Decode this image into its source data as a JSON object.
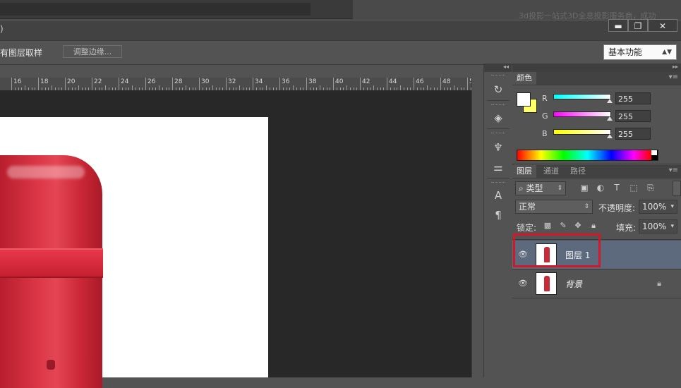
{
  "top": {
    "caption": "3d投影一站式3D全息投影服务商，成功"
  },
  "titlebar": {
    "paren": ")",
    "minimize": "▬",
    "restore": "❐",
    "close": "✕"
  },
  "options": {
    "sample_label": "有图层取样",
    "refine_edge": "调整边缘...",
    "workspace": "基本功能"
  },
  "ruler": {
    "numbers": [
      "16",
      "18",
      "20",
      "22",
      "24",
      "26",
      "28",
      "30",
      "32",
      "34",
      "36",
      "38",
      "40",
      "42",
      "44",
      "46",
      "48",
      "5"
    ]
  },
  "dock": {
    "collapse": "◂◂"
  },
  "color_panel": {
    "tab": "颜色",
    "channels": [
      {
        "label": "R",
        "value": "255"
      },
      {
        "label": "G",
        "value": "255"
      },
      {
        "label": "B",
        "value": "255"
      }
    ],
    "foreground": "#ffffff",
    "background": "#ffff66"
  },
  "panels": {
    "collapse": "▸▸",
    "menu": "▾≡"
  },
  "layers_panel": {
    "tabs": [
      "图层",
      "通道",
      "路径"
    ],
    "filter_kind": "类型",
    "blend_mode": "正常",
    "opacity_label": "不透明度:",
    "opacity_value": "100%",
    "lock_label": "锁定:",
    "fill_label": "填充:",
    "fill_value": "100%",
    "layers": [
      {
        "name": "图层 1",
        "selected": true
      },
      {
        "name": "背景",
        "selected": false,
        "locked": true
      }
    ]
  },
  "colors": {
    "accent_highlight": "#d1182a",
    "selected_layer": "#5d6a7e",
    "product_red": "#c72a39"
  }
}
